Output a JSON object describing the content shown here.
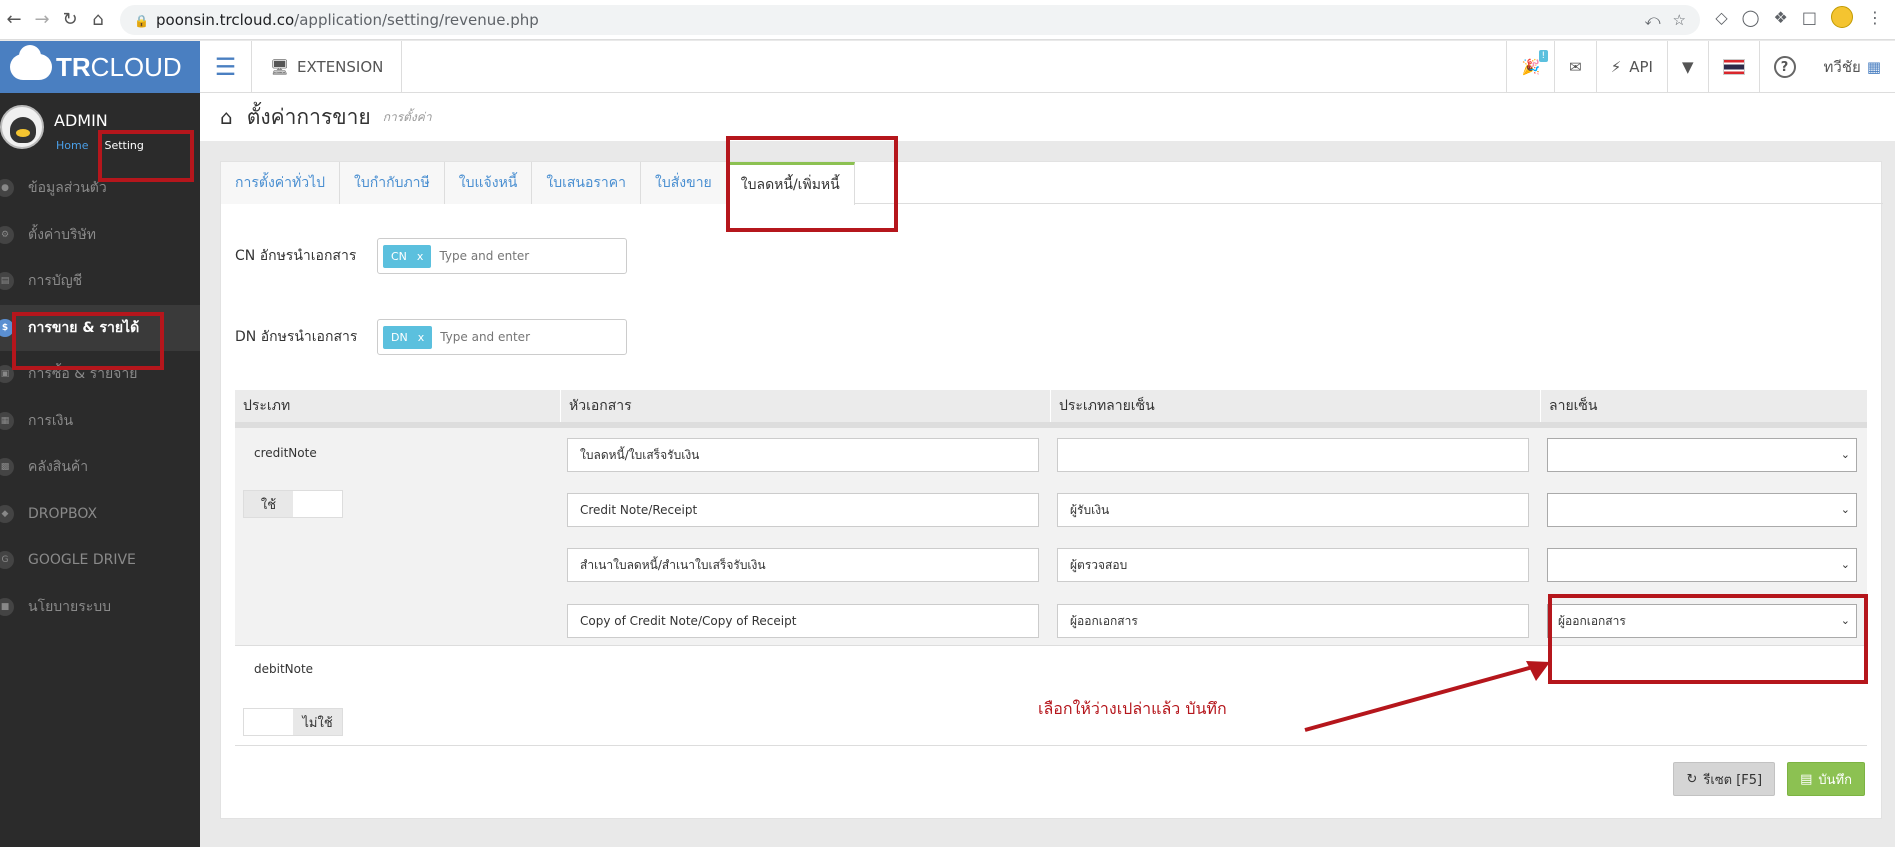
{
  "browser": {
    "domain": "poonsin.trcloud.co",
    "path": "/application/setting/revenue.php"
  },
  "header": {
    "logo_text_bold": "TR",
    "logo_text": "CLOUD",
    "extension_label": "EXTENSION",
    "notification_badge": "!",
    "api_label": "API",
    "user_short": "ทวีชัย"
  },
  "sidebar": {
    "username": "ADMIN",
    "home_link": "Home",
    "setting_link": "Setting",
    "items": [
      {
        "label": "ข้อมูลส่วนตัว",
        "icon": "user-icon"
      },
      {
        "label": "ตั้งค่าบริษัท",
        "icon": "gear-icon"
      },
      {
        "label": "การบัญชี",
        "icon": "book-icon"
      },
      {
        "label": "การขาย & รายได้",
        "icon": "dollar-icon"
      },
      {
        "label": "การซื้อ & รายจ่าย",
        "icon": "cart-icon"
      },
      {
        "label": "การเงิน",
        "icon": "calendar-icon"
      },
      {
        "label": "คลังสินค้า",
        "icon": "truck-icon"
      },
      {
        "label": "DROPBOX",
        "icon": "dropbox-icon"
      },
      {
        "label": "GOOGLE DRIVE",
        "icon": "google-icon"
      },
      {
        "label": "นโยบายระบบ",
        "icon": "lock-icon"
      }
    ]
  },
  "page": {
    "title": "ตั้งค่าการขาย",
    "subtitle": "การตั้งค่า"
  },
  "tabs": [
    {
      "label": "การตั้งค่าทั่วไป"
    },
    {
      "label": "ใบกำกับภาษี"
    },
    {
      "label": "ใบแจ้งหนี้"
    },
    {
      "label": "ใบเสนอราคา"
    },
    {
      "label": "ใบสั่งขาย"
    },
    {
      "label": "ใบลดหนี้/เพิ่มหนี้"
    }
  ],
  "prefix_fields": {
    "cn_label": "CN อักษรนำเอกสาร",
    "cn_tag": "CN",
    "dn_label": "DN อักษรนำเอกสาร",
    "dn_tag": "DN",
    "tag_remove": "x",
    "placeholder": "Type and enter"
  },
  "table": {
    "headers": [
      "ประเภท",
      "หัวเอกสาร",
      "ประเภทลายเซ็น",
      "ลายเซ็น"
    ],
    "credit": {
      "type": "creditNote",
      "toggle_label": "ใช้",
      "rows": [
        {
          "doc_title": "ใบลดหนี้/ใบเสร็จรับเงิน",
          "sign_type": "",
          "signature": ""
        },
        {
          "doc_title": "Credit Note/Receipt",
          "sign_type": "ผู้รับเงิน",
          "signature": ""
        },
        {
          "doc_title": "สำเนาใบลดหนี้/สำเนาใบเสร็จรับเงิน",
          "sign_type": "ผู้ตรวจสอบ",
          "signature": ""
        },
        {
          "doc_title": "Copy of Credit Note/Copy of Receipt",
          "sign_type": "ผู้ออกเอกสาร",
          "signature": "ผู้ออกเอกสาร"
        }
      ]
    },
    "debit": {
      "type": "debitNote",
      "toggle_label": "ไม่ใช้"
    }
  },
  "buttons": {
    "reset": "รีเซต [F5]",
    "save": "บันทึก"
  },
  "annotation": {
    "text": "เลือกให้ว่างเปล่าแล้ว บันทึก"
  },
  "colors": {
    "annotation_red": "#b5161c",
    "active_tab_accent": "#8cc152",
    "brand_blue": "#4a7fc1",
    "tag_color": "#5bc0de"
  }
}
